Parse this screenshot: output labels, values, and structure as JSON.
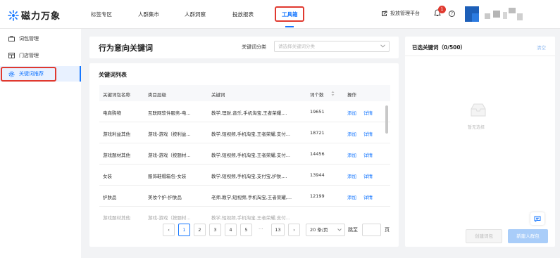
{
  "app": {
    "name": "磁力万象",
    "brand_color": "#1677ff",
    "highlight_color": "#e0392f"
  },
  "nav": {
    "items": [
      "标签专区",
      "人群集市",
      "人群洞察",
      "投放报表",
      "工具箱"
    ],
    "active_index": 4,
    "platform_label": "投放管理平台",
    "notification_count": "1"
  },
  "sidebar": {
    "items": [
      {
        "label": "词包管理",
        "icon": "package-icon"
      },
      {
        "label": "门店管理",
        "icon": "store-icon"
      },
      {
        "label": "关键词推荐",
        "icon": "gear-icon",
        "active": true
      }
    ]
  },
  "intent": {
    "title": "行为意向关键词",
    "category_label": "关键词分类",
    "category_placeholder": "请选择关键词分类"
  },
  "keyword_table": {
    "title": "关键词列表",
    "columns": [
      "关键词包名称",
      "类目层级",
      "关键词",
      "词个数",
      "操作"
    ],
    "rows": [
      {
        "name": "电商购物",
        "category": "互联网软件服务-电...",
        "keywords": "教学,理财,音乐,手机淘宝,王者荣耀,...",
        "count": "19651",
        "add": "添加",
        "detail": "详情"
      },
      {
        "name": "游戏利益其他",
        "category": "游戏-游戏（按利益...",
        "keywords": "教学,短视频,手机淘宝,王者荣耀,支付...",
        "count": "18721",
        "add": "添加",
        "detail": "详情"
      },
      {
        "name": "游戏题材其他",
        "category": "游戏-游戏（按题材...",
        "keywords": "教学,短视频,手机淘宝,王者荣耀,支付...",
        "count": "14456",
        "add": "添加",
        "detail": "详情"
      },
      {
        "name": "女装",
        "category": "服饰鞋帽箱包-女装",
        "keywords": "教学,短视频,手机淘宝,支付宝,护肤,...",
        "count": "13944",
        "add": "添加",
        "detail": "详情"
      },
      {
        "name": "护肤品",
        "category": "美妆个护-护肤品",
        "keywords": "老师,教学,短视频,手机淘宝,王者荣耀,...",
        "count": "12199",
        "add": "添加",
        "detail": "详情"
      }
    ]
  },
  "pagination": {
    "pages": [
      "1",
      "2",
      "3",
      "4",
      "5"
    ],
    "ellipsis": "···",
    "last_page": "13",
    "current": "1",
    "page_size": "20 条/页",
    "goto_label": "跳至",
    "page_unit": "页"
  },
  "selected": {
    "title": "已选关键词（0/500）",
    "clear_label": "清空",
    "empty_text": "暂无选择",
    "create_pack_label": "创建词包",
    "new_audience_label": "新建人群包"
  }
}
